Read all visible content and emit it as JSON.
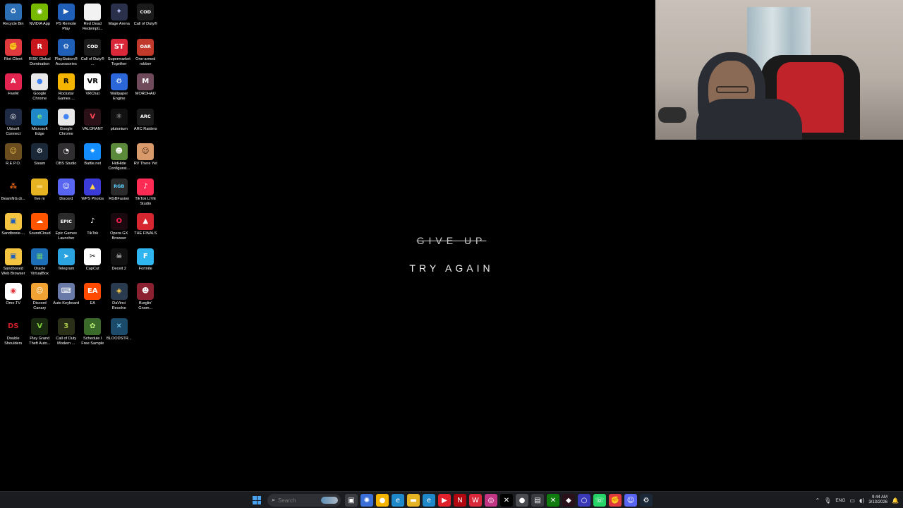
{
  "desktop": {
    "icons": [
      {
        "label": "Recycle Bin",
        "icon": "recycle-bin-icon",
        "glyph": "♻",
        "bg": "#2c6fb5",
        "fg": "#ffffff"
      },
      {
        "label": "NVIDIA App",
        "icon": "nvidia-icon",
        "glyph": "◉",
        "bg": "#76b900",
        "fg": "#ffffff"
      },
      {
        "label": "PS Remote Play",
        "icon": "ps-remote-play-icon",
        "glyph": "▶",
        "bg": "#1f5fb8",
        "fg": "#ffffff"
      },
      {
        "label": "Red Dead Redempti...",
        "icon": "document-icon",
        "glyph": "",
        "bg": "#f2f2f2",
        "fg": "#333333"
      },
      {
        "label": "Mage Arena",
        "icon": "mage-arena-icon",
        "glyph": "✦",
        "bg": "#2a2f4a",
        "fg": "#b9c8ff"
      },
      {
        "label": "Call of Duty®",
        "icon": "call-of-duty-icon",
        "glyph": "COD",
        "bg": "#1b1b1b",
        "fg": "#ffffff"
      },
      {
        "label": "Riot Client",
        "icon": "riot-client-icon",
        "glyph": "✊",
        "bg": "#e03a3e",
        "fg": "#ffffff"
      },
      {
        "label": "RISK Global Domination",
        "icon": "risk-icon",
        "glyph": "R",
        "bg": "#c8161d",
        "fg": "#ffffff"
      },
      {
        "label": "PlayStation® Accessories",
        "icon": "playstation-icon",
        "glyph": "⚙",
        "bg": "#1f5fb8",
        "fg": "#ffffff"
      },
      {
        "label": "Call of Duty® ...",
        "icon": "call-of-duty-icon",
        "glyph": "COD",
        "bg": "#1b1b1b",
        "fg": "#ffffff"
      },
      {
        "label": "Supermarket Together",
        "icon": "supermarket-together-icon",
        "glyph": "ST",
        "bg": "#d8283a",
        "fg": "#ffffff"
      },
      {
        "label": "One-armed robber",
        "icon": "one-armed-robber-icon",
        "glyph": "OAR",
        "bg": "#c0392b",
        "fg": "#ffffff"
      },
      {
        "label": "FiveM",
        "icon": "fivem-icon",
        "glyph": "A",
        "bg": "#e2244f",
        "fg": "#ffffff"
      },
      {
        "label": "Google Chrome",
        "icon": "chrome-icon",
        "glyph": "●",
        "bg": "#e8e8e8",
        "fg": "#4285f4"
      },
      {
        "label": "Rockstar Games ...",
        "icon": "rockstar-icon",
        "glyph": "R",
        "bg": "#f5b400",
        "fg": "#000000"
      },
      {
        "label": "VRChat",
        "icon": "vrchat-icon",
        "glyph": "VR",
        "bg": "#ffffff",
        "fg": "#000000"
      },
      {
        "label": "Wallpaper Engine",
        "icon": "wallpaper-engine-icon",
        "glyph": "⚙",
        "bg": "#2b67d8",
        "fg": "#ffffff"
      },
      {
        "label": "MORDHAU",
        "icon": "mordhau-icon",
        "glyph": "M",
        "bg": "#6e4a5a",
        "fg": "#ffffff"
      },
      {
        "label": "Ubisoft Connect",
        "icon": "ubisoft-icon",
        "glyph": "◎",
        "bg": "#1f2a44",
        "fg": "#ffffff"
      },
      {
        "label": "Microsoft Edge",
        "icon": "edge-icon",
        "glyph": "e",
        "bg": "#1e88c8",
        "fg": "#7be07b"
      },
      {
        "label": "Google Chrome",
        "icon": "chrome-icon",
        "glyph": "●",
        "bg": "#e8e8e8",
        "fg": "#4285f4"
      },
      {
        "label": "VALORANT",
        "icon": "valorant-icon",
        "glyph": "V",
        "bg": "#2b1018",
        "fg": "#ff4655"
      },
      {
        "label": "plutonium",
        "icon": "plutonium-icon",
        "glyph": "⚛",
        "bg": "#111111",
        "fg": "#cccccc"
      },
      {
        "label": "ARC Raiders",
        "icon": "arc-raiders-icon",
        "glyph": "ARC",
        "bg": "#1b1b1b",
        "fg": "#ffffff"
      },
      {
        "label": "R.E.P.O.",
        "icon": "repo-icon",
        "glyph": "☺",
        "bg": "#6b4d20",
        "fg": "#f2c14e"
      },
      {
        "label": "Steam",
        "icon": "steam-icon",
        "glyph": "⚙",
        "bg": "#1b2838",
        "fg": "#ffffff"
      },
      {
        "label": "OBS Studio",
        "icon": "obs-icon",
        "glyph": "◔",
        "bg": "#302e31",
        "fg": "#ffffff"
      },
      {
        "label": "Battle.net",
        "icon": "battlenet-icon",
        "glyph": "✷",
        "bg": "#148eff",
        "fg": "#ffffff"
      },
      {
        "label": "HidHide Configurat...",
        "icon": "hidhide-icon",
        "glyph": "☻",
        "bg": "#5a8a3a",
        "fg": "#ffffff"
      },
      {
        "label": "RV There Yet",
        "icon": "rv-there-yet-icon",
        "glyph": "☺",
        "bg": "#d89a6a",
        "fg": "#3a2010"
      },
      {
        "label": "BeamNG.dr...",
        "icon": "beamng-icon",
        "glyph": "⁂",
        "bg": "#000000",
        "fg": "#f26a1b"
      },
      {
        "label": "five m",
        "icon": "folder-icon",
        "glyph": "▬",
        "bg": "#e6b422",
        "fg": "#f7d36a"
      },
      {
        "label": "Discord",
        "icon": "discord-icon",
        "glyph": "☺",
        "bg": "#5865f2",
        "fg": "#ffffff"
      },
      {
        "label": "WPS Photos",
        "icon": "wps-photos-icon",
        "glyph": "▲",
        "bg": "#3b3bd8",
        "fg": "#ffd24a"
      },
      {
        "label": "RGBFusion",
        "icon": "rgbfusion-icon",
        "glyph": "RGB",
        "bg": "#2a2a2a",
        "fg": "#5ad1ff"
      },
      {
        "label": "TikTok LIVE Studio",
        "icon": "tiktok-live-icon",
        "glyph": "♪",
        "bg": "#fe2c55",
        "fg": "#ffffff"
      },
      {
        "label": "Sandboxie-...",
        "icon": "sandboxie-icon",
        "glyph": "▣",
        "bg": "#f5c542",
        "fg": "#1f5fb8"
      },
      {
        "label": "SoundCloud",
        "icon": "soundcloud-icon",
        "glyph": "☁",
        "bg": "#ff5500",
        "fg": "#ffffff"
      },
      {
        "label": "Epic Games Launcher",
        "icon": "epic-games-icon",
        "glyph": "EPIC",
        "bg": "#2a2a2a",
        "fg": "#ffffff"
      },
      {
        "label": "TikTok",
        "icon": "tiktok-icon",
        "glyph": "♪",
        "bg": "#000000",
        "fg": "#ffffff"
      },
      {
        "label": "Opera GX Browser",
        "icon": "opera-gx-icon",
        "glyph": "O",
        "bg": "#1a0a10",
        "fg": "#fa1e4e"
      },
      {
        "label": "THE FINALS",
        "icon": "the-finals-icon",
        "glyph": "▲",
        "bg": "#d6262f",
        "fg": "#ffffff"
      },
      {
        "label": "Sandboxed Web Browser",
        "icon": "sandboxed-browser-icon",
        "glyph": "▣",
        "bg": "#f5c542",
        "fg": "#1f5fb8"
      },
      {
        "label": "Oracle VirtualBox",
        "icon": "virtualbox-icon",
        "glyph": "▦",
        "bg": "#1d6fb8",
        "fg": "#6fd06f"
      },
      {
        "label": "Telegram",
        "icon": "telegram-icon",
        "glyph": "➤",
        "bg": "#2aa3e0",
        "fg": "#ffffff"
      },
      {
        "label": "CapCut",
        "icon": "capcut-icon",
        "glyph": "✂",
        "bg": "#ffffff",
        "fg": "#000000"
      },
      {
        "label": "Deceit 2",
        "icon": "deceit-icon",
        "glyph": "☠",
        "bg": "#111111",
        "fg": "#ffffff"
      },
      {
        "label": "Fortnite",
        "icon": "fortnite-icon",
        "glyph": "F",
        "bg": "#2fb5f0",
        "fg": "#ffffff"
      },
      {
        "label": "Ome.TV",
        "icon": "ometv-icon",
        "glyph": "◉",
        "bg": "#ffffff",
        "fg": "#e03a3e"
      },
      {
        "label": "Discord Canary",
        "icon": "discord-canary-icon",
        "glyph": "☺",
        "bg": "#f0a232",
        "fg": "#ffffff"
      },
      {
        "label": "Auto Keyboard",
        "icon": "auto-keyboard-icon",
        "glyph": "⌨",
        "bg": "#6a7aa8",
        "fg": "#ffffff"
      },
      {
        "label": "EA",
        "icon": "ea-icon",
        "glyph": "EA",
        "bg": "#ff4a00",
        "fg": "#ffffff"
      },
      {
        "label": "DaVinci Resolve",
        "icon": "davinci-resolve-icon",
        "glyph": "◈",
        "bg": "#2a3a4e",
        "fg": "#ffd24a"
      },
      {
        "label": "Burglin' Gnom...",
        "icon": "burglin-gnomes-icon",
        "glyph": "☻",
        "bg": "#8a2030",
        "fg": "#ffffff"
      },
      {
        "label": "Double Shoulders",
        "icon": "double-shoulders-icon",
        "glyph": "DS",
        "bg": "#000000",
        "fg": "#d0202a"
      },
      {
        "label": "Play Grand Theft Auto...",
        "icon": "gta-icon",
        "glyph": "V",
        "bg": "#1a2a10",
        "fg": "#7dcf3a"
      },
      {
        "label": "Call of Duty Modern ...",
        "icon": "call-of-duty-mw-icon",
        "glyph": "3",
        "bg": "#2a3018",
        "fg": "#a8c84a"
      },
      {
        "label": "Schedule I Free Sample",
        "icon": "schedule-one-icon",
        "glyph": "✿",
        "bg": "#3a6a2a",
        "fg": "#b8f07a"
      },
      {
        "label": "BLOODSTR...",
        "icon": "bloodstrike-icon",
        "glyph": "✕",
        "bg": "#1c4a6a",
        "fg": "#7ad8ff"
      }
    ]
  },
  "wallpaper": {
    "line1": "GIVE UP",
    "line2": "TRY AGAIN"
  },
  "taskbar": {
    "search_placeholder": "Search",
    "apps": [
      {
        "icon": "task-view-icon",
        "glyph": "▣",
        "bg": "#3a3b40"
      },
      {
        "icon": "copilot-icon",
        "glyph": "✺",
        "bg": "#3a6fd8"
      },
      {
        "icon": "chrome-icon",
        "glyph": "●",
        "bg": "#f4b400"
      },
      {
        "icon": "edge-icon",
        "glyph": "e",
        "bg": "#1e88c8"
      },
      {
        "icon": "file-explorer-icon",
        "glyph": "▬",
        "bg": "#e6b422"
      },
      {
        "icon": "edge-icon",
        "glyph": "e",
        "bg": "#1e88c8"
      },
      {
        "icon": "youtube-icon",
        "glyph": "▶",
        "bg": "#e0202a"
      },
      {
        "icon": "netflix-icon",
        "glyph": "N",
        "bg": "#b00710"
      },
      {
        "icon": "wps-office-icon",
        "glyph": "W",
        "bg": "#d8283a"
      },
      {
        "icon": "instagram-icon",
        "glyph": "◎",
        "bg": "#c13584"
      },
      {
        "icon": "x-twitter-icon",
        "glyph": "✕",
        "bg": "#000000"
      },
      {
        "icon": "chrome-icon",
        "glyph": "●",
        "bg": "#4a4b50"
      },
      {
        "icon": "file-manager-icon",
        "glyph": "▤",
        "bg": "#3a3b40"
      },
      {
        "icon": "xbox-icon",
        "glyph": "✕",
        "bg": "#107c10"
      },
      {
        "icon": "game-icon",
        "glyph": "◆",
        "bg": "#2a1018"
      },
      {
        "icon": "browser-icon",
        "glyph": "○",
        "bg": "#3a3ab8"
      },
      {
        "icon": "whatsapp-icon",
        "glyph": "☏",
        "bg": "#25d366"
      },
      {
        "icon": "riot-client-icon",
        "glyph": "✊",
        "bg": "#e03a3e"
      },
      {
        "icon": "discord-icon",
        "glyph": "☺",
        "bg": "#5865f2"
      },
      {
        "icon": "steam-icon",
        "glyph": "⚙",
        "bg": "#1b2838"
      }
    ],
    "tray": {
      "language": "ENG",
      "time": "9:44 AM",
      "date": "3/13/2026"
    }
  }
}
